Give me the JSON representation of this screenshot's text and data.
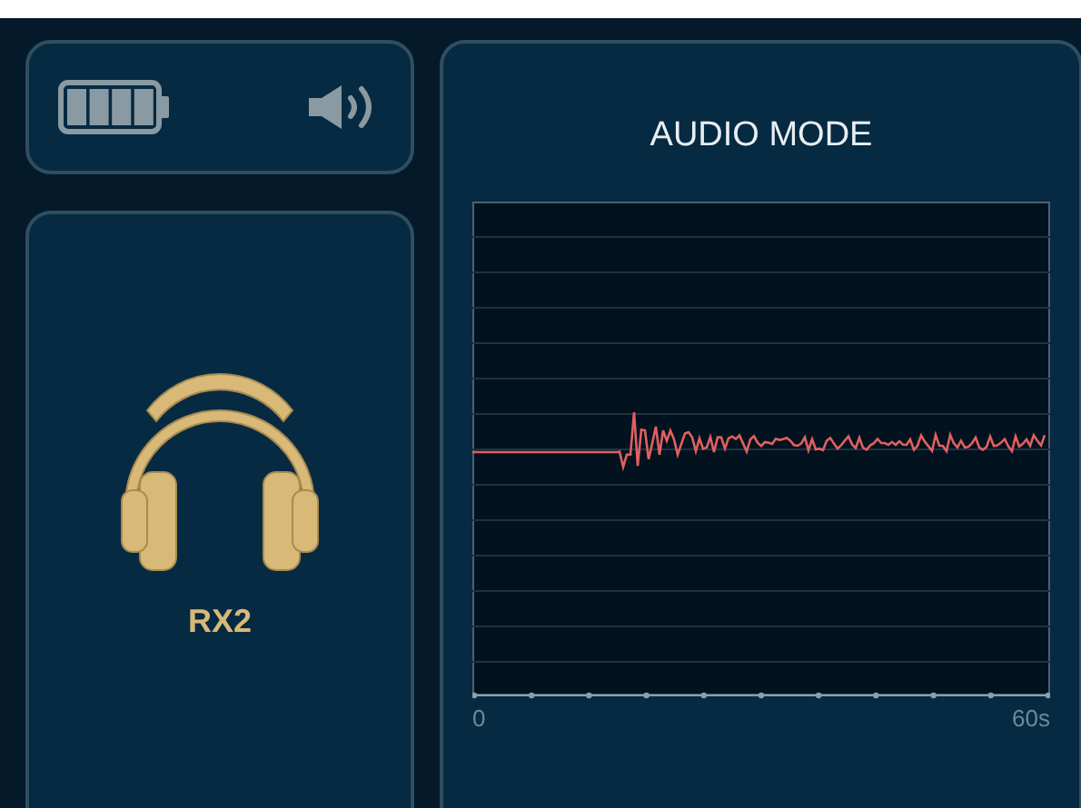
{
  "device": {
    "name": "RX2"
  },
  "mode_panel": {
    "title": "AUDIO MODE",
    "axis_labels": [
      "0",
      "60s"
    ]
  }
}
